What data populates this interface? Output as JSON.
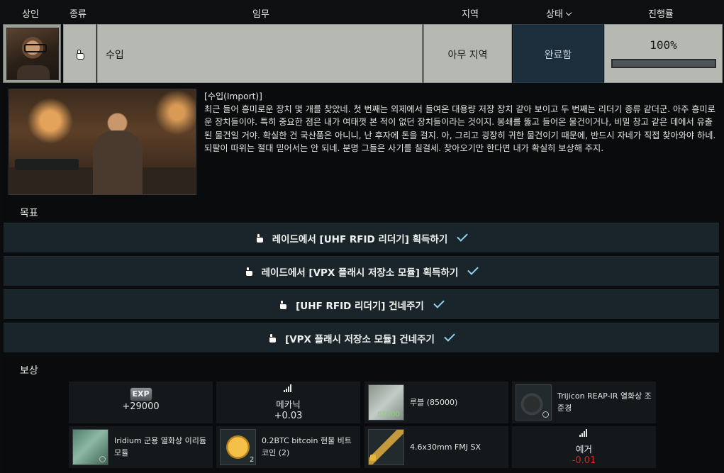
{
  "header": {
    "trader": "상인",
    "type": "종류",
    "task": "임무",
    "location": "지역",
    "status": "상태",
    "progress": "진행률"
  },
  "quest": {
    "name": "수입",
    "location": "아무 지역",
    "status": "완료함",
    "progress_text": "100%",
    "progress_fraction": 1.0,
    "status_color": "#1c2e3b"
  },
  "description": {
    "title": "[수입(Import)]",
    "body": "최근 들어 흥미로운 장치 몇 개를 찾았네. 첫 번째는 외제에서 들여온 대용량 저장 장치 같아 보이고 두 번째는 리더기 종류 같더군. 아주 흥미로운 장치들이야. 특히 중요한 점은 내가 여태껏 본 적이 없던 장치들이라는 것이지. 봉쇄를 뚫고 들어온 물건이거나, 비밀 창고 같은 데에서 유출된 물건일 거야. 확실한 건 국산품은 아니니, 난 후자에 돈을 걸지. 아, 그리고 굉장히 귀한 물건이기 때문에, 반드시 자네가 직접 찾아와야 하네. 되팔이 따위는 절대 믿어서는 안 되네. 분명 그들은 사기를 칠걸세. 찾아오기만 한다면 내가 확실히 보상해 주지."
  },
  "objectives_title": "목표",
  "objectives": [
    {
      "text": "레이드에서 [UHF RFID 리더기] 획득하기"
    },
    {
      "text": "레이드에서 [VPX 플래시 저장소 모듈] 획득하기"
    },
    {
      "text": "[UHF RFID 리더기] 건네주기"
    },
    {
      "text": "[VPX 플래시 저장소 모듈] 건네주기"
    }
  ],
  "rewards_title": "보상",
  "rewards": {
    "exp_badge": "EXP",
    "exp_value": "+29000",
    "mechanic_name": "메카닉",
    "mechanic_value": "+0.03",
    "roubles_label": "루블 (85000)",
    "roubles_amount": "85000",
    "trijicon_label": "Trijicon REAP-IR 열화상 조준경",
    "iridium_label": "Iridium 군용 열화상 이리듐 모듈",
    "bitcoin_label": "0.2BTC bitcoin 현물 비트 코인 (2)",
    "bitcoin_count": "2",
    "ammo_label": "4.6x30mm FMJ SX",
    "jaeger_name": "예거",
    "jaeger_value": "-0.01"
  },
  "icons": {
    "hand": "hand-pointer-icon",
    "check": "checkmark-icon",
    "chevron": "chevron-down-icon",
    "standing": "standing-chart-icon"
  },
  "colors": {
    "check": "#8fd3f0",
    "negative": "#d02727",
    "objective_bg": "#1a252b"
  }
}
